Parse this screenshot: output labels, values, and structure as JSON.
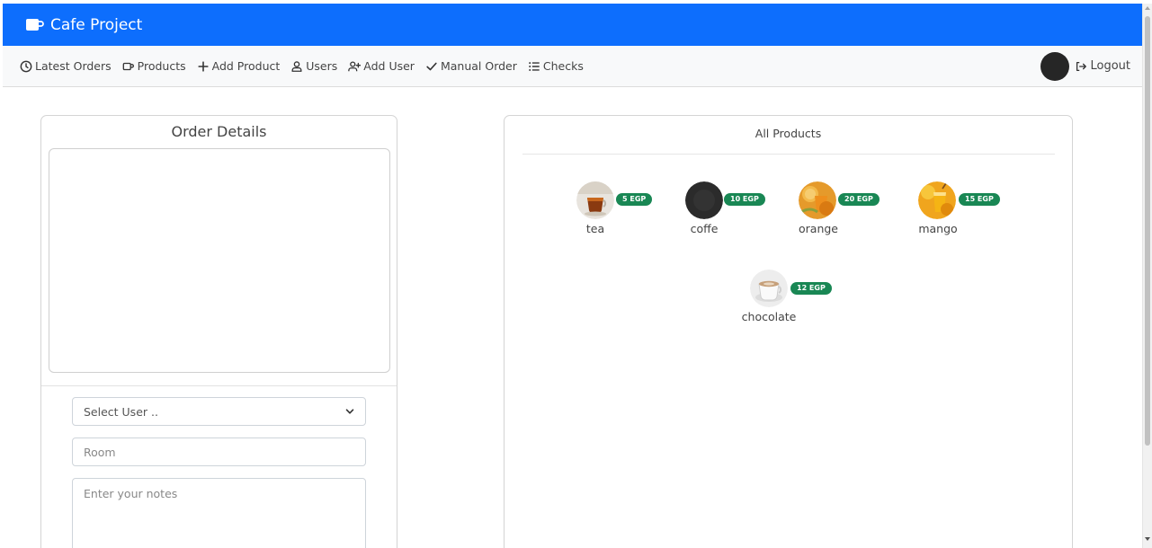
{
  "app": {
    "title": "Cafe Project"
  },
  "nav": {
    "links": [
      {
        "label": "Latest Orders",
        "icon": "clock-icon"
      },
      {
        "label": "Products",
        "icon": "cup-icon"
      },
      {
        "label": "Add Product",
        "icon": "plus-icon"
      },
      {
        "label": "Users",
        "icon": "user-icon"
      },
      {
        "label": "Add User",
        "icon": "user-plus-icon"
      },
      {
        "label": "Manual Order",
        "icon": "check-icon"
      },
      {
        "label": "Checks",
        "icon": "list-icon"
      }
    ],
    "logout_label": "Logout"
  },
  "order": {
    "title": "Order Details",
    "user_select": {
      "selected": "Select User .."
    },
    "room": {
      "placeholder": "Room"
    },
    "notes": {
      "placeholder": "Enter your notes"
    }
  },
  "products": {
    "title": "All Products",
    "items": [
      {
        "name": "tea",
        "price": "5 EGP"
      },
      {
        "name": "coffe",
        "price": "10 EGP"
      },
      {
        "name": "orange",
        "price": "20 EGP"
      },
      {
        "name": "mango",
        "price": "15 EGP"
      },
      {
        "name": "chocolate",
        "price": "12 EGP"
      }
    ]
  },
  "colors": {
    "brand": "#0d6efd",
    "price_badge": "#198754",
    "navbar_bg": "#f8f9fa"
  }
}
